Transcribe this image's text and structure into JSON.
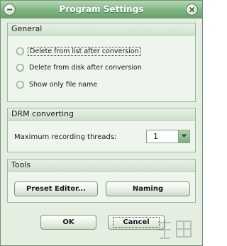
{
  "window": {
    "title": "Program Settings",
    "menu_icon": "minus-icon",
    "close_icon": "close-icon"
  },
  "general": {
    "header": "General",
    "options": [
      {
        "label": "Delete from list after conversion",
        "checked": false,
        "focused": true
      },
      {
        "label": "Delete from disk after conversion",
        "checked": false,
        "focused": false
      },
      {
        "label": "Show only file name",
        "checked": false,
        "focused": false
      }
    ]
  },
  "drm": {
    "header": "DRM converting",
    "threads_label": "Maximum recording threads:",
    "threads_value": "1"
  },
  "tools": {
    "header": "Tools",
    "preset_editor_label": "Preset Editor...",
    "naming_label": "Naming"
  },
  "footer": {
    "ok_label": "OK",
    "cancel_label": "Cancel"
  },
  "colors": {
    "titlebar": "#7fb583",
    "panel_bg": "#e4efe2",
    "border": "#9db79f"
  }
}
